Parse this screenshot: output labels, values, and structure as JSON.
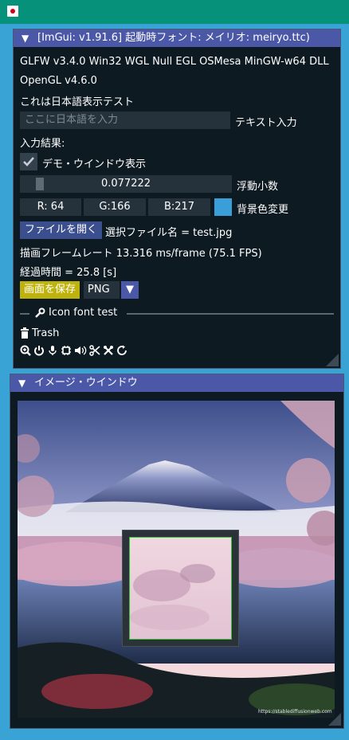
{
  "window": {
    "app_icon": "japan-flag-icon"
  },
  "main_window": {
    "title": "[ImGui: v1.91.6] 起動時フォント: メイリオ: meiryo.ttc)",
    "line1": "GLFW v3.4.0 Win32 WGL Null EGL OSMesa MinGW-w64 DLL",
    "line2": "OpenGL v4.6.0",
    "line3": "これは日本語表示テスト",
    "text_input": {
      "placeholder": "ここに日本語を入力",
      "label": "テキスト入力"
    },
    "input_result_label": "入力結果:",
    "demo_checkbox": {
      "label": "デモ・ウインドウ表示",
      "checked": true
    },
    "float_slider": {
      "value": "0.077222",
      "label": "浮動小数"
    },
    "color": {
      "r": "R: 64",
      "g": "G:166",
      "b": "B:217",
      "label": "背景色変更",
      "swatch": "#3a9fd8"
    },
    "file": {
      "button": "ファイルを開く",
      "selected": "選択ファイル名 = test.jpg"
    },
    "frame_rate": "描画フレームレート  13.316 ms/frame (75.1 FPS)",
    "elapsed": "経過時間 = 25.8 [s]",
    "save": {
      "button": "画面を保存",
      "format": "PNG"
    },
    "icon_section": {
      "label": "Icon font test",
      "trash_label": "Trash"
    },
    "icons": [
      "zoom-in-icon",
      "power-icon",
      "microphone-icon",
      "chip-icon",
      "volume-icon",
      "scissors-icon",
      "tools-icon",
      "refresh-icon"
    ]
  },
  "image_window": {
    "title": "イメージ・ウインドウ",
    "watermark": "https://stablediffusionweb.com"
  },
  "colors": {
    "title_bar": "#05917a",
    "background": "#3aa3d6",
    "window_title": "#4b58a8",
    "save_button": "#bfb20c"
  }
}
